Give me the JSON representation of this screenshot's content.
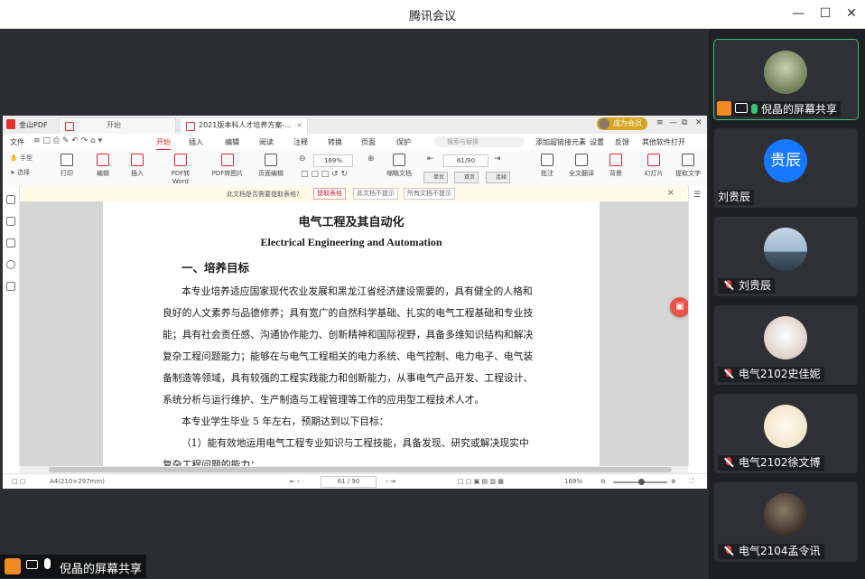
{
  "window": {
    "title": "腾讯会议"
  },
  "pdf_app": {
    "app_name": "金山PDF",
    "tabs": [
      {
        "label": "开始"
      },
      {
        "label": "2021版本科人才培养方案-..."
      }
    ],
    "member_badge": "成为会员",
    "menus": [
      "文件",
      "开始",
      "插入",
      "编辑",
      "阅读",
      "注释",
      "转换",
      "页面",
      "保护",
      "添加超链接元素",
      "设置",
      "反馈",
      "其他软件打开"
    ],
    "active_menu": "开始",
    "search_placeholder": "搜索与替换",
    "ribbon": {
      "hand_tool": "手型",
      "select_tool": "选择",
      "buttons": [
        "打印",
        "编辑",
        "插入",
        "PDF转Word",
        "PDF转图片",
        "页面编辑",
        "缩略文档",
        "批注",
        "全文翻译",
        "背景",
        "幻灯片",
        "提取文字"
      ],
      "zoom_value": "169%",
      "page_value": "61/90",
      "view_single": "单页",
      "view_double": "双页",
      "view_continuous": "连续"
    },
    "notice": {
      "text": "此文档是否需要提取表格?",
      "btn_extract": "提取表格",
      "btn_no_more": "此文档不提示",
      "btn_all_no": "所有文档不提示"
    },
    "document": {
      "title_cn": "电气工程及其自动化",
      "title_en": "Electrical Engineering and Automation",
      "section": "一、培养目标",
      "lines": [
        "本专业培养适应国家现代农业发展和黑龙江省经济建设需要的，具有健全的人格和",
        "良好的人文素养与品德修养；具有宽广的自然科学基础、扎实的电气工程基础和专业技",
        "能；具有社会责任感、沟通协作能力、创新精神和国际视野，具备多维知识结构和解决",
        "复杂工程问题能力；能够在与电气工程相关的电力系统、电气控制、电力电子、电气装",
        "备制造等领域，具有较强的工程实践能力和创新能力，从事电气产品开发、工程设计、",
        "系统分析与运行维护、生产制造与工程管理等工作的应用型工程技术人才。",
        "本专业学生毕业 5 年左右，预期达到以下目标：",
        "（1）能有效地运用电气工程专业知识与工程技能，具备发现、研究或解决现实中",
        "复杂工程问题的能力；"
      ]
    },
    "status": {
      "page_size": "A4(210×297mm)",
      "page_field": "61 / 90",
      "zoom": "169%"
    }
  },
  "share_banner": "倪晶的屏幕共享",
  "participants": [
    {
      "name": "倪晶的屏幕共享",
      "avatar_color": "#8b9a6a",
      "status": "sharing",
      "active": true
    },
    {
      "name": "刘贵辰",
      "avatar_text": "贵辰",
      "avatar_color": "#1677ff",
      "status": "none",
      "active": false
    },
    {
      "name": "刘贵辰",
      "avatar_color": "#7fa4c4",
      "status": "muted",
      "active": false
    },
    {
      "name": "电气2102史佳妮",
      "avatar_color": "#e9e2dc",
      "status": "muted",
      "active": false
    },
    {
      "name": "电气2102徐文博",
      "avatar_color": "#f6f1e4",
      "status": "muted",
      "active": false
    },
    {
      "name": "电气2104孟令讯",
      "avatar_color": "#4a3b30",
      "status": "muted",
      "active": false
    }
  ]
}
